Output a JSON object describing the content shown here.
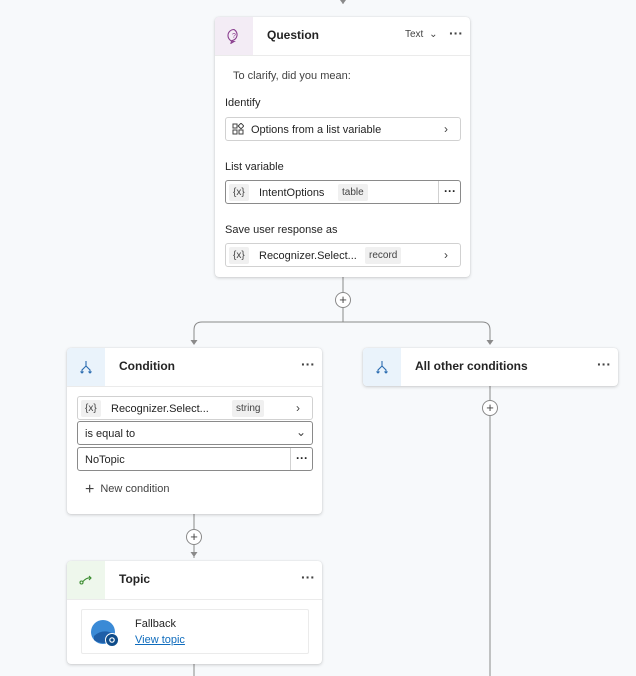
{
  "question": {
    "title": "Question",
    "type_label": "Text",
    "more_label": "···",
    "prompt": "To clarify, did you mean:",
    "identify_label": "Identify",
    "identify_value": "Options from a list variable",
    "list_variable_label": "List variable",
    "list_var_token": "{x}",
    "list_var_name": "IntentOptions",
    "list_var_type": "table",
    "save_label": "Save user response as",
    "save_token": "{x}",
    "save_name": "Recognizer.Select...",
    "save_type": "record"
  },
  "condition": {
    "title": "Condition",
    "more_label": "···",
    "var_token": "{x}",
    "var_name": "Recognizer.Select...",
    "var_type": "string",
    "operator": "is equal to",
    "value": "NoTopic",
    "new_condition_label": "New condition"
  },
  "other_conditions": {
    "title": "All other conditions",
    "more_label": "···"
  },
  "topic": {
    "title": "Topic",
    "more_label": "···",
    "name": "Fallback",
    "link_label": "View topic"
  },
  "colors": {
    "canvas": "#f7f9fb",
    "connector": "#8a8a8a",
    "question_icon_bg": "#f3ecf5",
    "condition_icon_bg": "#eaf3fb",
    "topic_icon_bg": "#eef7ec",
    "link": "#0f6cbd"
  }
}
